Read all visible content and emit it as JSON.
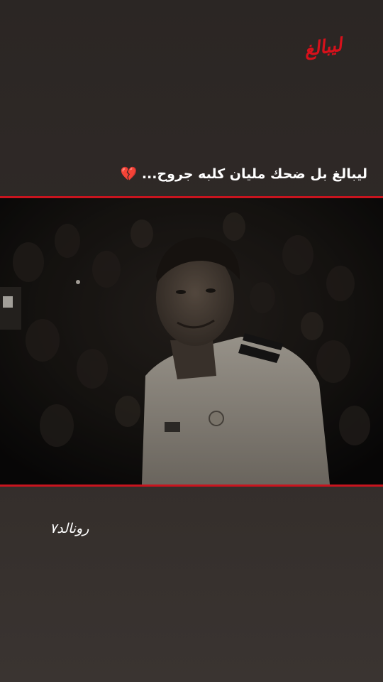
{
  "logo": {
    "text": "ليبالغ"
  },
  "caption": {
    "text": "ليبالغ بل ضحك مليان كلبه جروح...",
    "emoji": "💔"
  },
  "video": {
    "accent_line_color": "#c8141e"
  },
  "signature": {
    "text": "رونالد٧"
  }
}
